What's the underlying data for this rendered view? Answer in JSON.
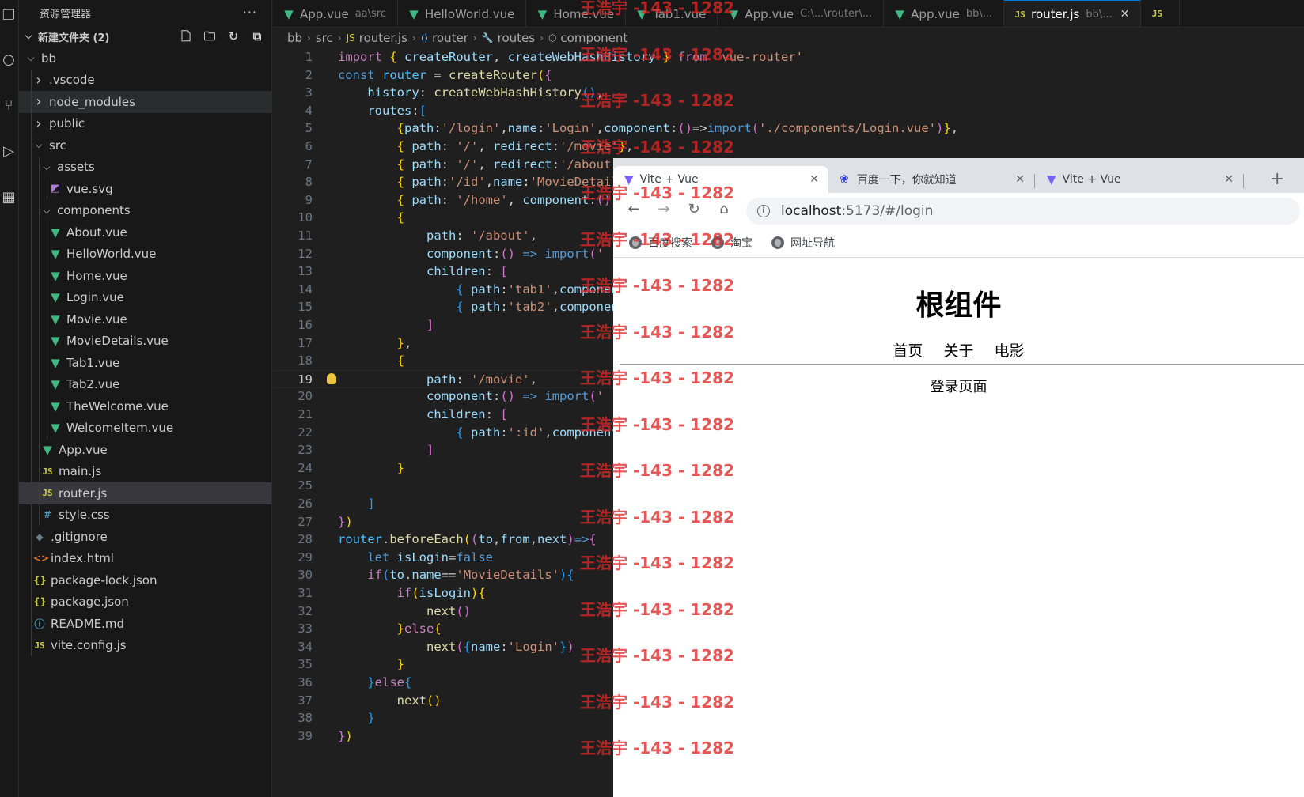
{
  "explorer": {
    "title": "资源管理器",
    "section": "新建文件夹 (2)",
    "tree": [
      {
        "label": "bb",
        "depth": 1,
        "kind": "folder-open"
      },
      {
        "label": ".vscode",
        "depth": 2,
        "kind": "folder"
      },
      {
        "label": "node_modules",
        "depth": 2,
        "kind": "folder",
        "state": "hover"
      },
      {
        "label": "public",
        "depth": 2,
        "kind": "folder"
      },
      {
        "label": "src",
        "depth": 2,
        "kind": "folder-open"
      },
      {
        "label": "assets",
        "depth": 3,
        "kind": "folder-open"
      },
      {
        "label": "vue.svg",
        "depth": 4,
        "kind": "svg"
      },
      {
        "label": "components",
        "depth": 3,
        "kind": "folder-open"
      },
      {
        "label": "About.vue",
        "depth": 4,
        "kind": "vue"
      },
      {
        "label": "HelloWorld.vue",
        "depth": 4,
        "kind": "vue"
      },
      {
        "label": "Home.vue",
        "depth": 4,
        "kind": "vue"
      },
      {
        "label": "Login.vue",
        "depth": 4,
        "kind": "vue"
      },
      {
        "label": "Movie.vue",
        "depth": 4,
        "kind": "vue"
      },
      {
        "label": "MovieDetails.vue",
        "depth": 4,
        "kind": "vue"
      },
      {
        "label": "Tab1.vue",
        "depth": 4,
        "kind": "vue"
      },
      {
        "label": "Tab2.vue",
        "depth": 4,
        "kind": "vue"
      },
      {
        "label": "TheWelcome.vue",
        "depth": 4,
        "kind": "vue"
      },
      {
        "label": "WelcomeItem.vue",
        "depth": 4,
        "kind": "vue"
      },
      {
        "label": "App.vue",
        "depth": 3,
        "kind": "vue"
      },
      {
        "label": "main.js",
        "depth": 3,
        "kind": "js"
      },
      {
        "label": "router.js",
        "depth": 3,
        "kind": "js",
        "state": "selected"
      },
      {
        "label": "style.css",
        "depth": 3,
        "kind": "css"
      },
      {
        "label": ".gitignore",
        "depth": 2,
        "kind": "git"
      },
      {
        "label": "index.html",
        "depth": 2,
        "kind": "html"
      },
      {
        "label": "package-lock.json",
        "depth": 2,
        "kind": "json"
      },
      {
        "label": "package.json",
        "depth": 2,
        "kind": "json"
      },
      {
        "label": "README.md",
        "depth": 2,
        "kind": "info"
      },
      {
        "label": "vite.config.js",
        "depth": 2,
        "kind": "js"
      }
    ]
  },
  "tabs": [
    {
      "label": "App.vue",
      "desc": "aa\\src",
      "icon": "vue"
    },
    {
      "label": "HelloWorld.vue",
      "desc": "",
      "icon": "vue"
    },
    {
      "label": "Home.vue",
      "desc": "",
      "icon": "vue"
    },
    {
      "label": "Tab1.vue",
      "desc": "",
      "icon": "vue"
    },
    {
      "label": "App.vue",
      "desc": "C:\\...\\router\\...",
      "icon": "vue"
    },
    {
      "label": "App.vue",
      "desc": "bb\\...",
      "icon": "vue"
    },
    {
      "label": "router.js",
      "desc": "bb\\...",
      "icon": "js",
      "active": true
    },
    {
      "label": "",
      "desc": "",
      "icon": "js"
    }
  ],
  "breadcrumbs": [
    "bb",
    "src",
    "router.js",
    "router",
    "routes",
    "component"
  ],
  "editor": {
    "current_line": 19,
    "lines": [
      [
        [
          "kw",
          "import"
        ],
        [
          "pl",
          " "
        ],
        [
          "br1",
          "{"
        ],
        [
          "pl",
          " "
        ],
        [
          "var",
          "createRouter"
        ],
        [
          "pl",
          ", "
        ],
        [
          "var",
          "createWebHashHistory"
        ],
        [
          "pl",
          " "
        ],
        [
          "br1",
          "}"
        ],
        [
          "pl",
          " "
        ],
        [
          "kw",
          "from"
        ],
        [
          "pl",
          " "
        ],
        [
          "str",
          "'vue-router'"
        ]
      ],
      [
        [
          "bl",
          "const"
        ],
        [
          "pl",
          " "
        ],
        [
          "cls",
          "router"
        ],
        [
          "pl",
          " = "
        ],
        [
          "fn",
          "createRouter"
        ],
        [
          "br1",
          "("
        ],
        [
          "br2",
          "{"
        ]
      ],
      [
        [
          "pl",
          "    "
        ],
        [
          "var",
          "history"
        ],
        [
          "pl",
          ": "
        ],
        [
          "fn",
          "createWebHashHistory"
        ],
        [
          "br3",
          "()"
        ],
        [
          "pl",
          ","
        ]
      ],
      [
        [
          "pl",
          "    "
        ],
        [
          "var",
          "routes"
        ],
        [
          "pl",
          ":"
        ],
        [
          "br3",
          "["
        ]
      ],
      [
        [
          "pl",
          "        "
        ],
        [
          "br1",
          "{"
        ],
        [
          "var",
          "path"
        ],
        [
          "pl",
          ":"
        ],
        [
          "str",
          "'/login'"
        ],
        [
          "pl",
          ","
        ],
        [
          "var",
          "name"
        ],
        [
          "pl",
          ":"
        ],
        [
          "str",
          "'Login'"
        ],
        [
          "pl",
          ","
        ],
        [
          "var",
          "component"
        ],
        [
          "pl",
          ":"
        ],
        [
          "br2",
          "()"
        ],
        [
          "pl",
          "=>"
        ],
        [
          "bl",
          "import"
        ],
        [
          "br2",
          "("
        ],
        [
          "str",
          "'./components/Login.vue'"
        ],
        [
          "br2",
          ")"
        ],
        [
          "br1",
          "}"
        ],
        [
          "pl",
          ","
        ]
      ],
      [
        [
          "pl",
          "        "
        ],
        [
          "br1",
          "{"
        ],
        [
          "pl",
          " "
        ],
        [
          "var",
          "path"
        ],
        [
          "pl",
          ": "
        ],
        [
          "str",
          "'/'"
        ],
        [
          "pl",
          ", "
        ],
        [
          "var",
          "redirect"
        ],
        [
          "pl",
          ":"
        ],
        [
          "str",
          "'/movie'"
        ],
        [
          "br1",
          "}"
        ],
        [
          "pl",
          ","
        ]
      ],
      [
        [
          "pl",
          "        "
        ],
        [
          "br1",
          "{"
        ],
        [
          "pl",
          " "
        ],
        [
          "var",
          "path"
        ],
        [
          "pl",
          ": "
        ],
        [
          "str",
          "'/'"
        ],
        [
          "pl",
          ", "
        ],
        [
          "var",
          "redirect"
        ],
        [
          "pl",
          ":"
        ],
        [
          "str",
          "'/about'"
        ]
      ],
      [
        [
          "pl",
          "        "
        ],
        [
          "br1",
          "{"
        ],
        [
          "pl",
          " "
        ],
        [
          "var",
          "path"
        ],
        [
          "pl",
          ":"
        ],
        [
          "str",
          "'/id'"
        ],
        [
          "pl",
          ","
        ],
        [
          "var",
          "name"
        ],
        [
          "pl",
          ":"
        ],
        [
          "str",
          "'MovieDetails'"
        ]
      ],
      [
        [
          "pl",
          "        "
        ],
        [
          "br1",
          "{"
        ],
        [
          "pl",
          " "
        ],
        [
          "var",
          "path"
        ],
        [
          "pl",
          ": "
        ],
        [
          "str",
          "'/home'"
        ],
        [
          "pl",
          ", "
        ],
        [
          "var",
          "component"
        ],
        [
          "pl",
          ":"
        ],
        [
          "br2",
          "()"
        ]
      ],
      [
        [
          "pl",
          "        "
        ],
        [
          "br1",
          "{"
        ]
      ],
      [
        [
          "pl",
          "            "
        ],
        [
          "var",
          "path"
        ],
        [
          "pl",
          ": "
        ],
        [
          "str",
          "'/about'"
        ],
        [
          "pl",
          ","
        ]
      ],
      [
        [
          "pl",
          "            "
        ],
        [
          "var",
          "component"
        ],
        [
          "pl",
          ":"
        ],
        [
          "br2",
          "()"
        ],
        [
          "pl",
          " "
        ],
        [
          "bl",
          "=>"
        ],
        [
          "pl",
          " "
        ],
        [
          "bl",
          "import"
        ],
        [
          "br2",
          "("
        ],
        [
          "str",
          "'"
        ]
      ],
      [
        [
          "pl",
          "            "
        ],
        [
          "var",
          "children"
        ],
        [
          "pl",
          ": "
        ],
        [
          "br2",
          "["
        ]
      ],
      [
        [
          "pl",
          "                "
        ],
        [
          "br3",
          "{"
        ],
        [
          "pl",
          " "
        ],
        [
          "var",
          "path"
        ],
        [
          "pl",
          ":"
        ],
        [
          "str",
          "'tab1'"
        ],
        [
          "pl",
          ","
        ],
        [
          "var",
          "component"
        ]
      ],
      [
        [
          "pl",
          "                "
        ],
        [
          "br3",
          "{"
        ],
        [
          "pl",
          " "
        ],
        [
          "var",
          "path"
        ],
        [
          "pl",
          ":"
        ],
        [
          "str",
          "'tab2'"
        ],
        [
          "pl",
          ","
        ],
        [
          "var",
          "component"
        ]
      ],
      [
        [
          "pl",
          "            "
        ],
        [
          "br2",
          "]"
        ]
      ],
      [
        [
          "pl",
          "        "
        ],
        [
          "br1",
          "}"
        ],
        [
          "pl",
          ","
        ]
      ],
      [
        [
          "pl",
          "        "
        ],
        [
          "br1",
          "{"
        ]
      ],
      [
        [
          "pl",
          "            "
        ],
        [
          "var",
          "path"
        ],
        [
          "pl",
          ": "
        ],
        [
          "str",
          "'/movie'"
        ],
        [
          "pl",
          ","
        ]
      ],
      [
        [
          "pl",
          "            "
        ],
        [
          "var",
          "component"
        ],
        [
          "pl",
          ":"
        ],
        [
          "br2",
          "()"
        ],
        [
          "pl",
          " "
        ],
        [
          "bl",
          "=>"
        ],
        [
          "pl",
          " "
        ],
        [
          "bl",
          "import"
        ],
        [
          "br2",
          "("
        ],
        [
          "str",
          "'"
        ]
      ],
      [
        [
          "pl",
          "            "
        ],
        [
          "var",
          "children"
        ],
        [
          "pl",
          ": "
        ],
        [
          "br2",
          "["
        ]
      ],
      [
        [
          "pl",
          "                "
        ],
        [
          "br3",
          "{"
        ],
        [
          "pl",
          " "
        ],
        [
          "var",
          "path"
        ],
        [
          "pl",
          ":"
        ],
        [
          "str",
          "':id'"
        ],
        [
          "pl",
          ","
        ],
        [
          "var",
          "component"
        ]
      ],
      [
        [
          "pl",
          "            "
        ],
        [
          "br2",
          "]"
        ]
      ],
      [
        [
          "pl",
          "        "
        ],
        [
          "br1",
          "}"
        ]
      ],
      [
        [
          "pl",
          ""
        ]
      ],
      [
        [
          "pl",
          "    "
        ],
        [
          "br3",
          "]"
        ]
      ],
      [
        [
          "br2",
          "}"
        ],
        [
          "br1",
          ")"
        ]
      ],
      [
        [
          "cls",
          "router"
        ],
        [
          "pl",
          "."
        ],
        [
          "fn",
          "beforeEach"
        ],
        [
          "br1",
          "("
        ],
        [
          "br2",
          "("
        ],
        [
          "var",
          "to"
        ],
        [
          "pl",
          ","
        ],
        [
          "var",
          "from"
        ],
        [
          "pl",
          ","
        ],
        [
          "var",
          "next"
        ],
        [
          "br2",
          ")"
        ],
        [
          "bl",
          "=>"
        ],
        [
          "br2",
          "{"
        ]
      ],
      [
        [
          "pl",
          "    "
        ],
        [
          "bl",
          "let"
        ],
        [
          "pl",
          " "
        ],
        [
          "var",
          "isLogin"
        ],
        [
          "pl",
          "="
        ],
        [
          "bl",
          "false"
        ]
      ],
      [
        [
          "pl",
          "    "
        ],
        [
          "kw",
          "if"
        ],
        [
          "br3",
          "("
        ],
        [
          "var",
          "to"
        ],
        [
          "pl",
          "."
        ],
        [
          "var",
          "name"
        ],
        [
          "pl",
          "=="
        ],
        [
          "str",
          "'MovieDetails'"
        ],
        [
          "br3",
          ")"
        ],
        [
          "br3",
          "{"
        ]
      ],
      [
        [
          "pl",
          "        "
        ],
        [
          "kw",
          "if"
        ],
        [
          "br1",
          "("
        ],
        [
          "var",
          "isLogin"
        ],
        [
          "br1",
          ")"
        ],
        [
          "br1",
          "{"
        ]
      ],
      [
        [
          "pl",
          "            "
        ],
        [
          "fn",
          "next"
        ],
        [
          "br2",
          "()"
        ]
      ],
      [
        [
          "pl",
          "        "
        ],
        [
          "br1",
          "}"
        ],
        [
          "kw",
          "else"
        ],
        [
          "br1",
          "{"
        ]
      ],
      [
        [
          "pl",
          "            "
        ],
        [
          "fn",
          "next"
        ],
        [
          "br2",
          "("
        ],
        [
          "br3",
          "{"
        ],
        [
          "var",
          "name"
        ],
        [
          "pl",
          ":"
        ],
        [
          "str",
          "'Login'"
        ],
        [
          "br3",
          "}"
        ],
        [
          "br2",
          ")"
        ]
      ],
      [
        [
          "pl",
          "        "
        ],
        [
          "br1",
          "}"
        ]
      ],
      [
        [
          "pl",
          "    "
        ],
        [
          "br3",
          "}"
        ],
        [
          "kw",
          "else"
        ],
        [
          "br3",
          "{"
        ]
      ],
      [
        [
          "pl",
          "        "
        ],
        [
          "fn",
          "next"
        ],
        [
          "br1",
          "()"
        ]
      ],
      [
        [
          "pl",
          "    "
        ],
        [
          "br3",
          "}"
        ]
      ],
      [
        [
          "br2",
          "}"
        ],
        [
          "br1",
          ")"
        ]
      ]
    ]
  },
  "browser": {
    "tabs": [
      {
        "title": "Vite + Vue",
        "active": true,
        "icon": "vite"
      },
      {
        "title": "百度一下，你就知道",
        "active": false,
        "icon": "baidu"
      },
      {
        "title": "Vite + Vue",
        "active": false,
        "icon": "vite"
      }
    ],
    "url_host": "localhost",
    "url_rest": ":5173/#/login",
    "bookmarks": [
      "百度搜索",
      "淘宝",
      "网址导航"
    ],
    "page": {
      "title": "根组件",
      "nav": [
        "首页",
        "关于",
        "电影"
      ],
      "content": "登录页面"
    }
  },
  "watermark": {
    "text": "王浩宇 -143 - 1282",
    "count": 17
  }
}
